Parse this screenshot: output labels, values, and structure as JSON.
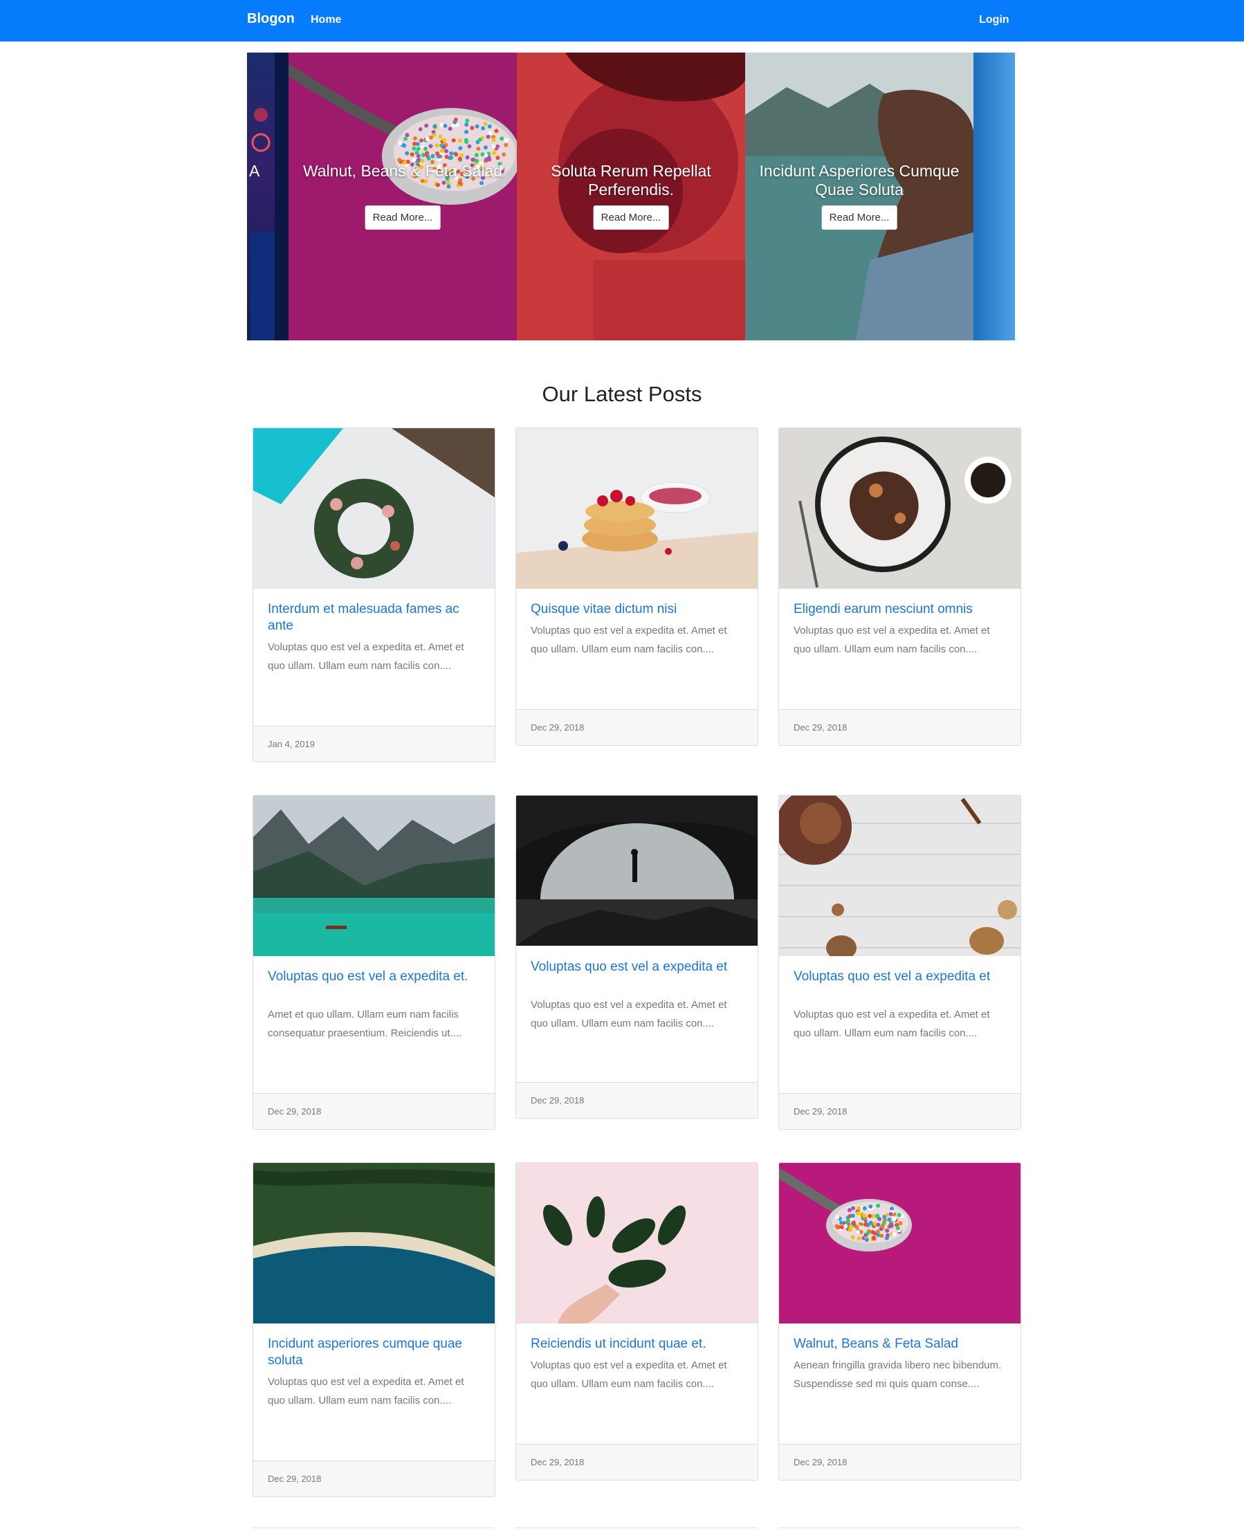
{
  "navbar": {
    "brand": "Blogon",
    "home": "Home",
    "login": "Login"
  },
  "carousel": {
    "edge_left_letter": "A",
    "read_more": "Read More...",
    "slides": [
      {
        "title": "Walnut, Beans & Feta Salad"
      },
      {
        "title": "Soluta Rerum Repellat Perferendis."
      },
      {
        "title": "Incidunt Asperiores Cumque Quae Soluta"
      }
    ]
  },
  "section_title": "Our Latest Posts",
  "posts": [
    {
      "title": "Interdum et malesuada fames ac ante",
      "excerpt": "Voluptas quo est vel a expedita et. Amet et quo ullam. Ullam eum nam facilis con....",
      "date": "Jan 4, 2019",
      "image": "wreath"
    },
    {
      "title": "Quisque vitae dictum nisi",
      "excerpt": "Voluptas quo est vel a expedita et. Amet et quo ullam. Ullam eum nam facilis con....",
      "date": "Dec 29, 2018",
      "image": "pancakes"
    },
    {
      "title": "Eligendi earum nesciunt omnis",
      "excerpt": "Voluptas quo est vel a expedita et. Amet et quo ullam. Ullam eum nam facilis con....",
      "date": "Dec 29, 2018",
      "image": "plate-coffee"
    },
    {
      "title": "Voluptas quo est vel a expedita et.",
      "excerpt": "Amet et quo ullam. Ullam eum nam facilis consequatur praesentium. Reiciendis ut....",
      "date": "Dec 29, 2018",
      "image": "mountain-lake"
    },
    {
      "title": "Voluptas quo est vel a expedita et",
      "excerpt": "Voluptas quo est vel a expedita et. Amet et quo ullam. Ullam eum nam facilis con....",
      "date": "Dec 29, 2018",
      "image": "cave"
    },
    {
      "title": "Voluptas quo est vel a expedita et",
      "excerpt": "Voluptas quo est vel a expedita et. Amet et quo ullam. Ullam eum nam facilis con....",
      "date": "Dec 29, 2018",
      "image": "pinecones"
    },
    {
      "title": "Incidunt asperiores cumque quae soluta",
      "excerpt": "Voluptas quo est vel a expedita et. Amet et quo ullam. Ullam eum nam facilis con....",
      "date": "Dec 29, 2018",
      "image": "coast"
    },
    {
      "title": "Reiciendis ut incidunt quae et.",
      "excerpt": "Voluptas quo est vel a expedita et. Amet et quo ullam. Ullam eum nam facilis con....",
      "date": "Dec 29, 2018",
      "image": "leaves"
    },
    {
      "title": "Walnut, Beans & Feta Salad",
      "excerpt": "Aenean fringilla gravida libero nec bibendum. Suspendisse sed mi quis quam conse....",
      "date": "Dec 29, 2018",
      "image": "sprinkles-spoon"
    }
  ],
  "colors": {
    "navbar": "#067bfc",
    "link": "#1a76d8"
  }
}
